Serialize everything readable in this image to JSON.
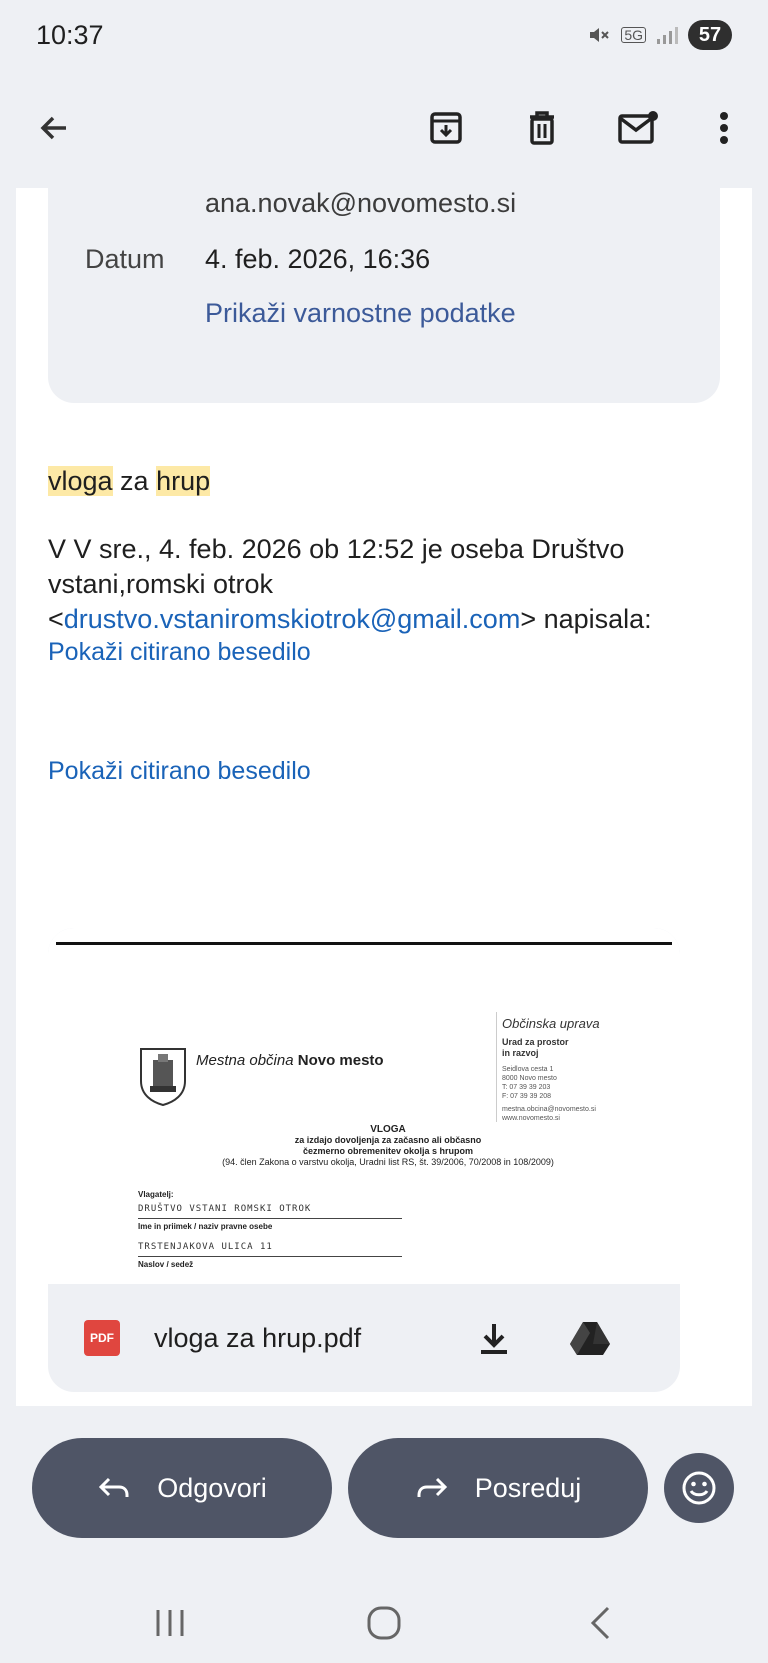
{
  "status_bar": {
    "time": "10:37",
    "network": "5G",
    "battery": "57"
  },
  "app_bar": {
    "icons": [
      "back-arrow-icon",
      "archive-icon",
      "delete-icon",
      "mark-unread-icon",
      "more-vert-icon"
    ]
  },
  "header_card": {
    "email": "ana.novak@novomesto.si",
    "date_label": "Datum",
    "date_value": "4. feb. 2026, 16:36",
    "security_link": "Prikaži varnostne podatke"
  },
  "message": {
    "subject_word1": "vloga",
    "subject_word2": " za ",
    "subject_word3": "hrup",
    "intro": "V V sre., 4. feb. 2026 ob 12:52 je oseba Društvo vstani,romski otrok <",
    "intro_email": "drustvo.vstaniromskiotrok@gmail.com",
    "intro_end": "> napisala:",
    "quoted_1": "Pokaži citirano besedilo",
    "quoted_2": "Pokaži citirano besedilo"
  },
  "attachment": {
    "badge": "PDF",
    "filename": "vloga za hrup.pdf",
    "preview": {
      "municipality_prefix": "Mestna občina ",
      "municipality_name": "Novo mesto",
      "office_title": "Občinska uprava",
      "office_dept_1": "Urad za prostor",
      "office_dept_2": "in razvoj",
      "office_address_1": "Seidlova cesta 1",
      "office_address_2": "8000 Novo mesto",
      "office_phone": "T: 07 39 39 203",
      "office_fax": "F: 07 39 39 208",
      "office_email": "mestna.obcina@novomesto.si",
      "office_web": "www.novomesto.si",
      "doc_title": "VLOGA",
      "doc_subtitle_1": "za izdajo dovoljenja za začasno ali občasno",
      "doc_subtitle_2": "čezmerno obremenitev okolja s hrupom",
      "doc_subtitle_3": "(94. člen Zakona o varstvu okolja, Uradni list RS, št. 39/2006, 70/2008 in 108/2009)",
      "label_applicant": "Vlagatelj:",
      "applicant_value": "DRUŠTVO VSTANI ROMSKI OTROK",
      "label_name": "Ime in priimek / naziv pravne osebe",
      "address_value": "TRSTENJAKOVA ULICA 11",
      "label_address": "Naslov / sedež"
    }
  },
  "actions": {
    "reply": "Odgovori",
    "forward": "Posreduj"
  },
  "colors": {
    "accent_link": "#1a63b8",
    "highlight": "#fde9a6",
    "pill_bg": "#4f5566",
    "surface": "#eef0f4"
  }
}
